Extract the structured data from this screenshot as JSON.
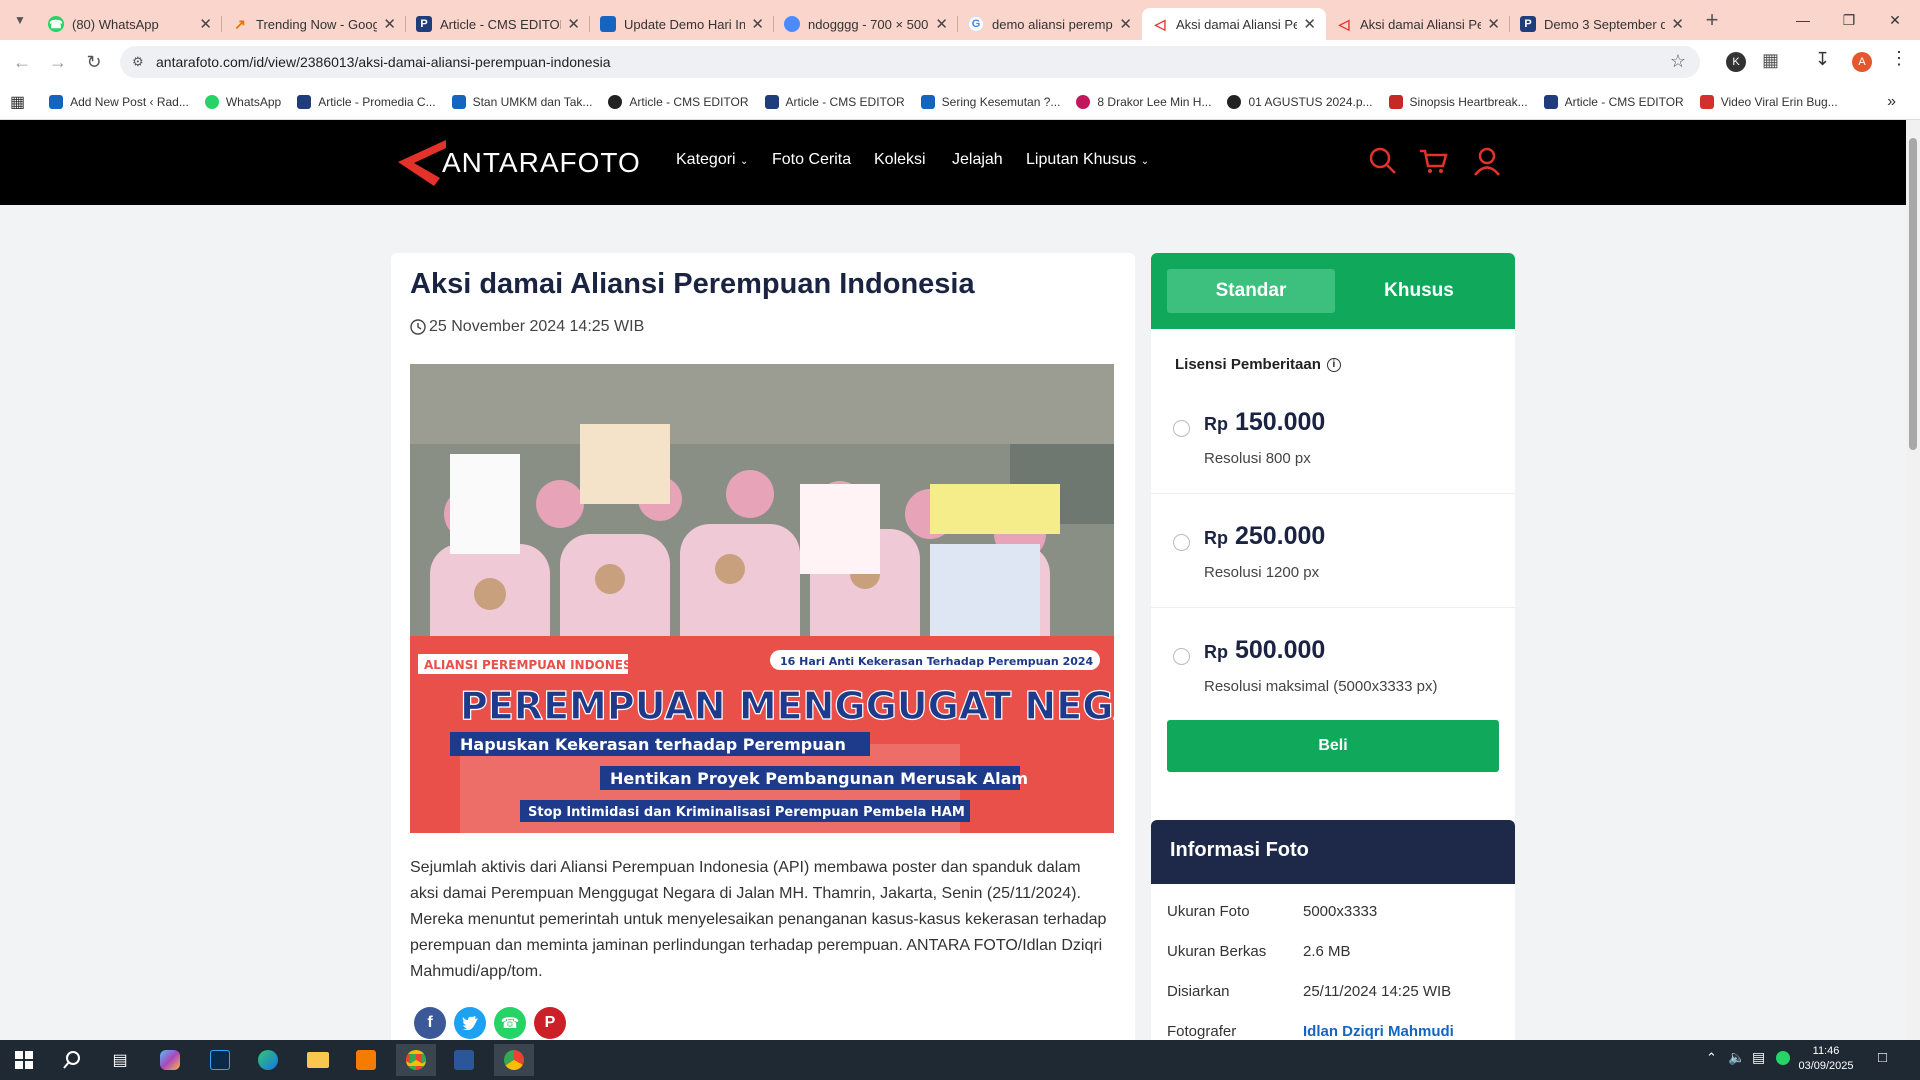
{
  "browser": {
    "tabs": [
      {
        "title": "(80) WhatsApp",
        "color": "#25d366"
      },
      {
        "title": "Trending Now - Goog",
        "color": "#e8710a"
      },
      {
        "title": "Article - CMS EDITOR",
        "color": "#1f3d7a"
      },
      {
        "title": "Update Demo Hari In",
        "color": "#1565c0"
      },
      {
        "title": "ndogggg - 700 × 500",
        "color": "#4a8cff"
      },
      {
        "title": "demo aliansi peremp",
        "color": "#4285f4"
      },
      {
        "title": "Aksi damai Aliansi Pe",
        "color": "#e4322b"
      },
      {
        "title": "Aksi damai Aliansi Pe",
        "color": "#e4322b"
      },
      {
        "title": "Demo 3 September d",
        "color": "#1f3d7a"
      }
    ],
    "url": "antarafoto.com/id/view/2386013/aksi-damai-aliansi-perempuan-indonesia",
    "profile_initial": "A",
    "ext_initial": "K",
    "bookmarks": [
      "Add New Post ‹ Rad...",
      "WhatsApp",
      "Article - Promedia C...",
      "Stan UMKM dan Tak...",
      "Article - CMS EDITOR",
      "Article - CMS EDITOR",
      "Sering Kesemutan ?...",
      "8 Drakor Lee Min H...",
      "01 AGUSTUS 2024.p...",
      "Sinopsis Heartbreak...",
      "Article - CMS EDITOR",
      "Video Viral Erin Bug..."
    ]
  },
  "site": {
    "logo_text": "ANTARAFOTO",
    "menu": [
      "Kategori",
      "Foto Cerita",
      "Koleksi",
      "Jelajah",
      "Liputan Khusus"
    ],
    "accent": "#e4322b"
  },
  "article": {
    "title": "Aksi damai Aliansi Perempuan Indonesia",
    "date": "25 November 2024 14:25 WIB",
    "banner": {
      "org": "ALIANSI PEREMPUAN INDONESIA",
      "event": "16 Hari Anti Kekerasan Terhadap Perempuan 2024",
      "headline": "PEREMPUAN MENGGUGAT NEGARA",
      "line1": "Hapuskan Kekerasan terhadap Perempuan",
      "line2": "Hentikan Proyek Pembangunan Merusak Alam",
      "line3": "Stop Intimidasi dan Kriminalisasi Perempuan Pembela HAM"
    },
    "caption": "Sejumlah aktivis dari Aliansi Perempuan Indonesia (API) membawa poster dan spanduk dalam aksi damai Perempuan Menggugat Negara di Jalan MH. Thamrin, Jakarta, Senin (25/11/2024). Mereka menuntut pemerintah untuk menyelesaikan penanganan kasus-kasus kekerasan terhadap perempuan dan meminta jaminan perlindungan terhadap perempuan. ANTARA FOTO/Idlan Dziqri Mahmudi/app/tom."
  },
  "license": {
    "tab_standard": "Standar",
    "tab_special": "Khusus",
    "heading": "Lisensi Pemberitaan",
    "currency": "Rp",
    "options": [
      {
        "price": "150.000",
        "resolution": "Resolusi 800 px"
      },
      {
        "price": "250.000",
        "resolution": "Resolusi 1200 px"
      },
      {
        "price": "500.000",
        "resolution": "Resolusi maksimal (5000x3333 px)"
      }
    ],
    "buy_label": "Beli"
  },
  "info": {
    "heading": "Informasi Foto",
    "rows": [
      {
        "label": "Ukuran Foto",
        "value": "5000x3333"
      },
      {
        "label": "Ukuran Berkas",
        "value": "2.6 MB"
      },
      {
        "label": "Disiarkan",
        "value": "25/11/2024 14:25 WIB"
      },
      {
        "label": "Fotografer",
        "value": "Idlan Dziqri Mahmudi"
      }
    ]
  },
  "taskbar": {
    "time": "11:46",
    "date": "03/09/2025"
  }
}
